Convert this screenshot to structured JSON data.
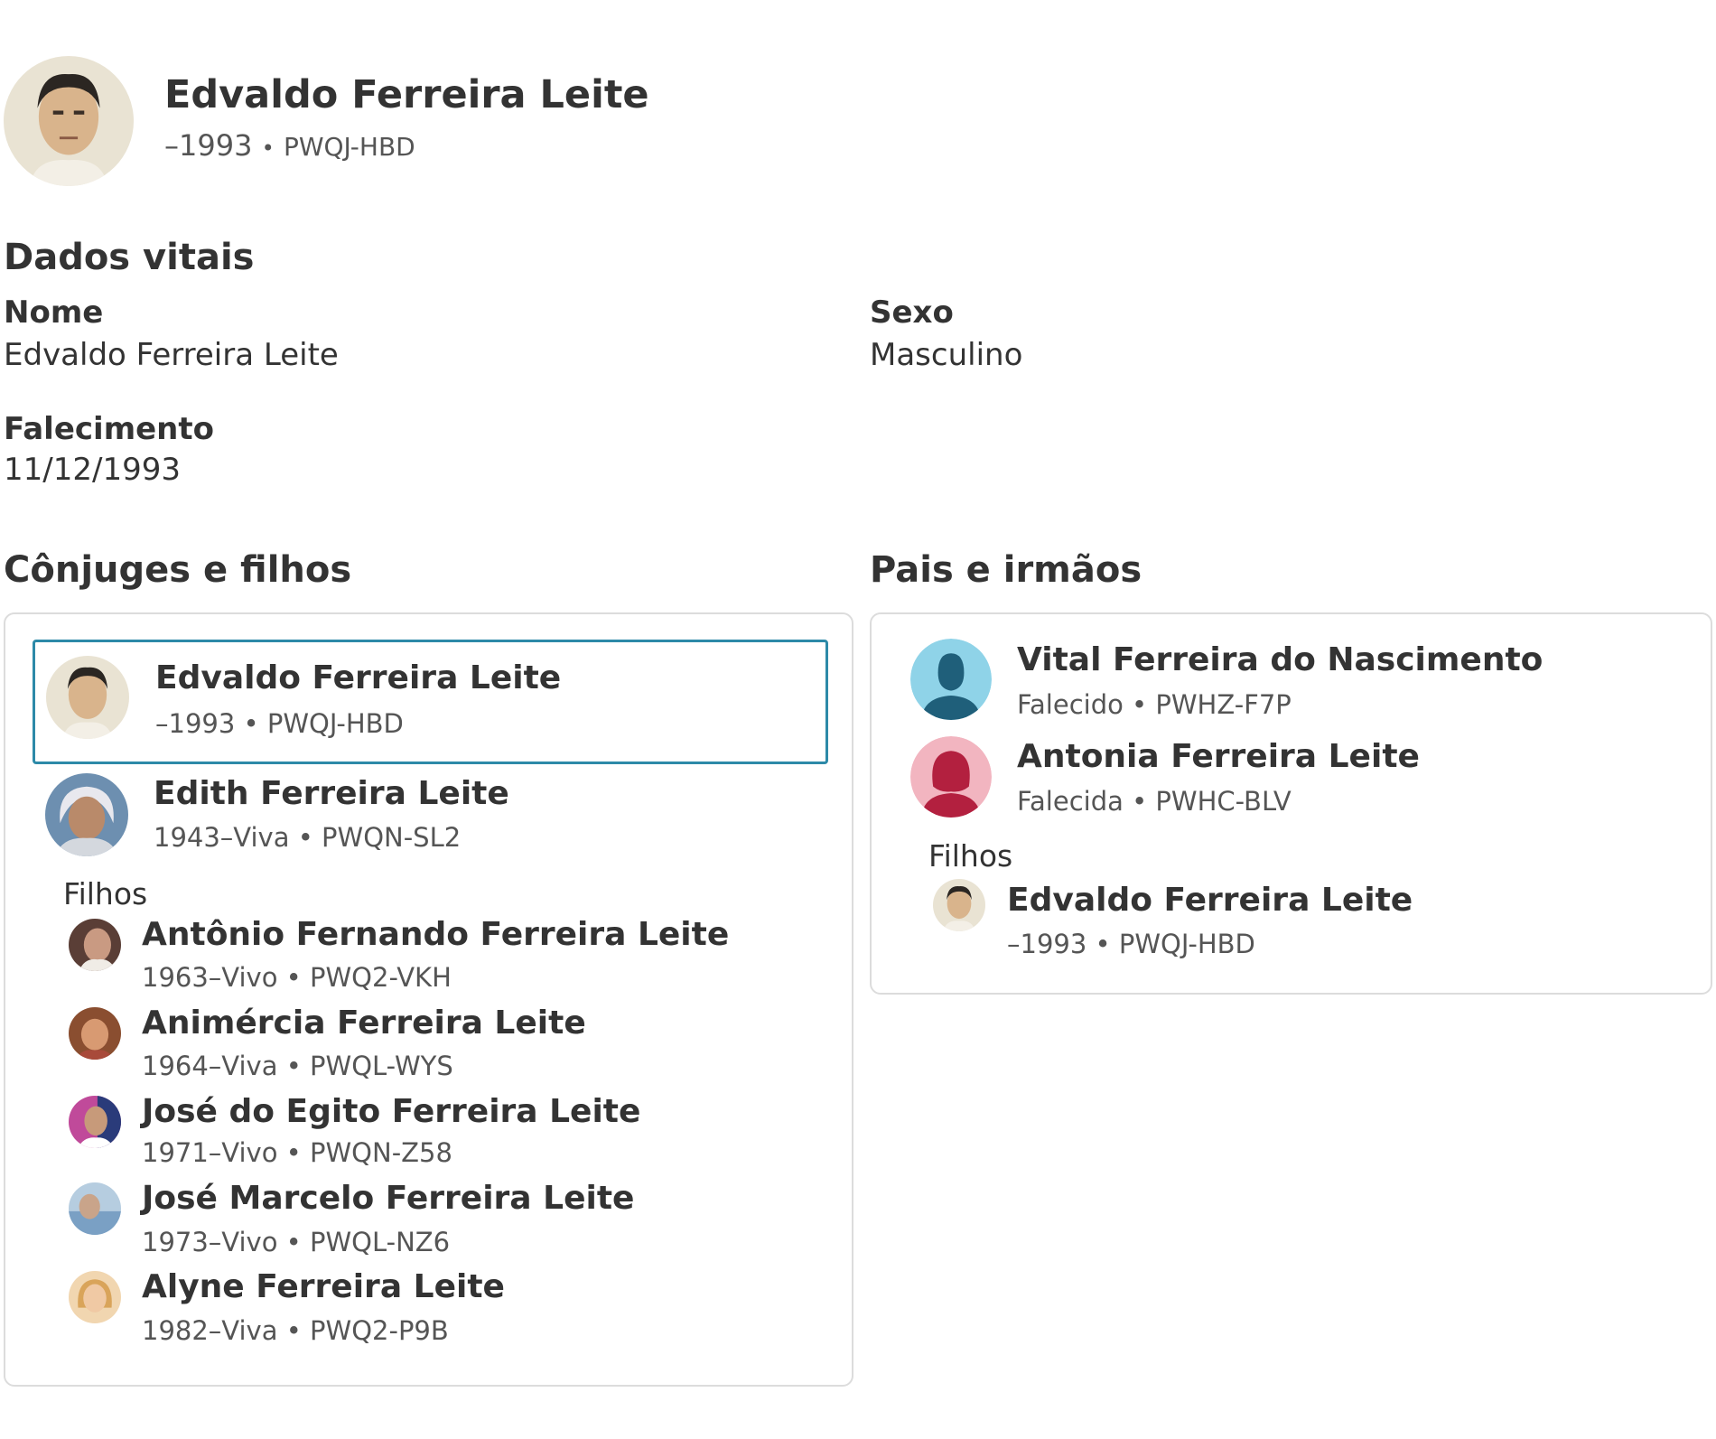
{
  "header": {
    "name": "Edvaldo Ferreira Leite",
    "dates": "–1993",
    "separator": "•",
    "pid": "PWQJ-HBD"
  },
  "vitals": {
    "title": "Dados vitais",
    "name_label": "Nome",
    "name_value": "Edvaldo Ferreira Leite",
    "sex_label": "Sexo",
    "sex_value": "Masculino",
    "death_label": "Falecimento",
    "death_value": "11/12/1993"
  },
  "spouses_children": {
    "title": "Cônjuges e filhos",
    "self": {
      "name": "Edvaldo Ferreira Leite",
      "meta": "–1993 • PWQJ-HBD"
    },
    "spouse": {
      "name": "Edith Ferreira Leite",
      "meta": "1943–Viva • PWQN-SL2"
    },
    "children_label": "Filhos",
    "children": [
      {
        "name": "Antônio Fernando Ferreira Leite",
        "meta": "1963–Vivo • PWQ2-VKH"
      },
      {
        "name": "Animércia Ferreira Leite",
        "meta": "1964–Viva • PWQL-WYS"
      },
      {
        "name": "José do Egito Ferreira Leite",
        "meta": "1971–Vivo • PWQN-Z58"
      },
      {
        "name": "José Marcelo Ferreira Leite",
        "meta": "1973–Vivo • PWQL-NZ6"
      },
      {
        "name": "Alyne Ferreira Leite",
        "meta": "1982–Viva • PWQ2-P9B"
      }
    ]
  },
  "parents_siblings": {
    "title": "Pais e irmãos",
    "father": {
      "name": "Vital Ferreira do Nascimento",
      "meta": "Falecido • PWHZ-F7P"
    },
    "mother": {
      "name": "Antonia Ferreira Leite",
      "meta": "Falecida • PWHC-BLV"
    },
    "children_label": "Filhos",
    "children": [
      {
        "name": "Edvaldo Ferreira Leite",
        "meta": "–1993 • PWQJ-HBD"
      }
    ]
  },
  "colors": {
    "selected_border": "#2d8aa8",
    "male_placeholder_bg": "#8fd3e8",
    "male_placeholder_fg": "#1f5f7a",
    "female_placeholder_bg": "#f2b5c0",
    "female_placeholder_fg": "#b3203f",
    "card_border": "#dcdcdc"
  },
  "icons": {
    "male": "male-silhouette-icon",
    "female": "female-silhouette-icon"
  }
}
